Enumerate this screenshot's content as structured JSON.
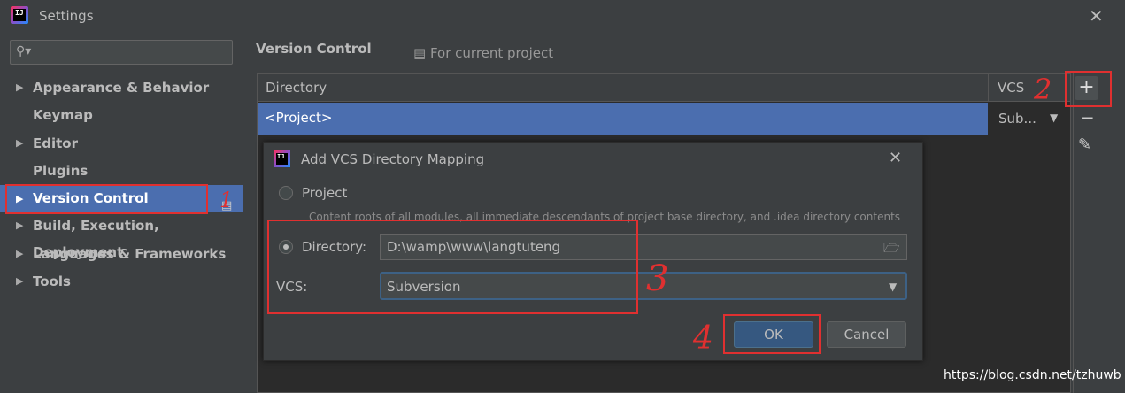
{
  "window": {
    "title": "Settings",
    "logo_text": "IJ",
    "close_icon": "close-icon"
  },
  "sidebar": {
    "search_placeholder": "",
    "items": [
      {
        "label": "Appearance & Behavior",
        "expandable": true
      },
      {
        "label": "Keymap",
        "expandable": false
      },
      {
        "label": "Editor",
        "expandable": true
      },
      {
        "label": "Plugins",
        "expandable": false
      },
      {
        "label": "Version Control",
        "expandable": true,
        "selected": true
      },
      {
        "label": "Build, Execution, Deployment",
        "expandable": true
      },
      {
        "label": "Languages & Frameworks",
        "expandable": true
      },
      {
        "label": "Tools",
        "expandable": true
      }
    ]
  },
  "main": {
    "title": "Version Control",
    "scope": "For current project",
    "table": {
      "columns": [
        "Directory",
        "VCS"
      ],
      "rows": [
        {
          "directory": "<Project>",
          "vcs": "Sub..."
        }
      ]
    }
  },
  "dialog": {
    "title": "Add VCS Directory Mapping",
    "logo_text": "IJ",
    "project_option": "Project",
    "project_desc": "Content roots of all modules, all immediate descendants of project base directory, and .idea directory contents",
    "directory_option": "Directory:",
    "directory_value": "D:\\wamp\\www\\langtuteng",
    "vcs_label": "VCS:",
    "vcs_value": "Subversion",
    "ok_label": "OK",
    "cancel_label": "Cancel"
  },
  "annotations": {
    "n1": "1",
    "n2": "2",
    "n3": "3",
    "n4": "4",
    "color": "#e03030"
  },
  "watermark": "https://blog.csdn.net/tzhuwb",
  "colors": {
    "selection": "#4b6eaf",
    "background": "#3c3f41",
    "table_bg": "#2b2b2b"
  }
}
